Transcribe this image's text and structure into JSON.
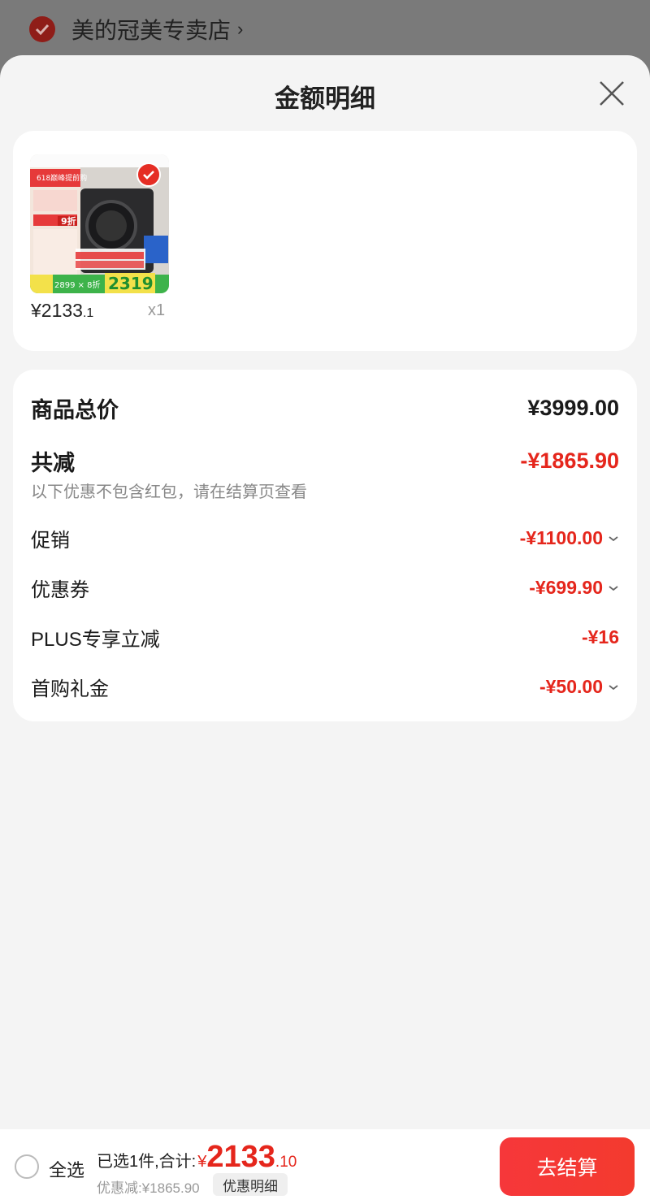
{
  "store": {
    "name": "美的冠美专卖店",
    "arrow": "›"
  },
  "sheet": {
    "title": "金额明细"
  },
  "product": {
    "price_int": "¥2133",
    "price_dec": ".1",
    "quantity": "x1",
    "badge_price": "2319",
    "badge_formula": "2899 × 8折",
    "badge_top": "618巅峰提前购",
    "badge_discount": "9折"
  },
  "details": {
    "total_label": "商品总价",
    "total_value": "¥3999.00",
    "reduce_label": "共减",
    "reduce_value": "-¥1865.90",
    "note": "以下优惠不包含红包，请在结算页查看",
    "items": [
      {
        "label": "促销",
        "value": "-¥1100.00",
        "expandable": true
      },
      {
        "label": "优惠券",
        "value": "-¥699.90",
        "expandable": true
      },
      {
        "label": "PLUS专享立减",
        "value": "-¥16",
        "expandable": false
      },
      {
        "label": "首购礼金",
        "value": "-¥50.00",
        "expandable": true
      }
    ]
  },
  "bottom": {
    "select_all": "全选",
    "selected_summary": "已选1件,合计:",
    "currency": "¥",
    "total_int": "2133",
    "total_dec": ".10",
    "discount_text": "优惠减:¥1865.90",
    "detail_button": "优惠明细",
    "checkout_button": "去结算"
  },
  "colors": {
    "accent": "#e5261c",
    "checkout": "#f6373a",
    "sheet_bg": "#f4f4f4"
  }
}
